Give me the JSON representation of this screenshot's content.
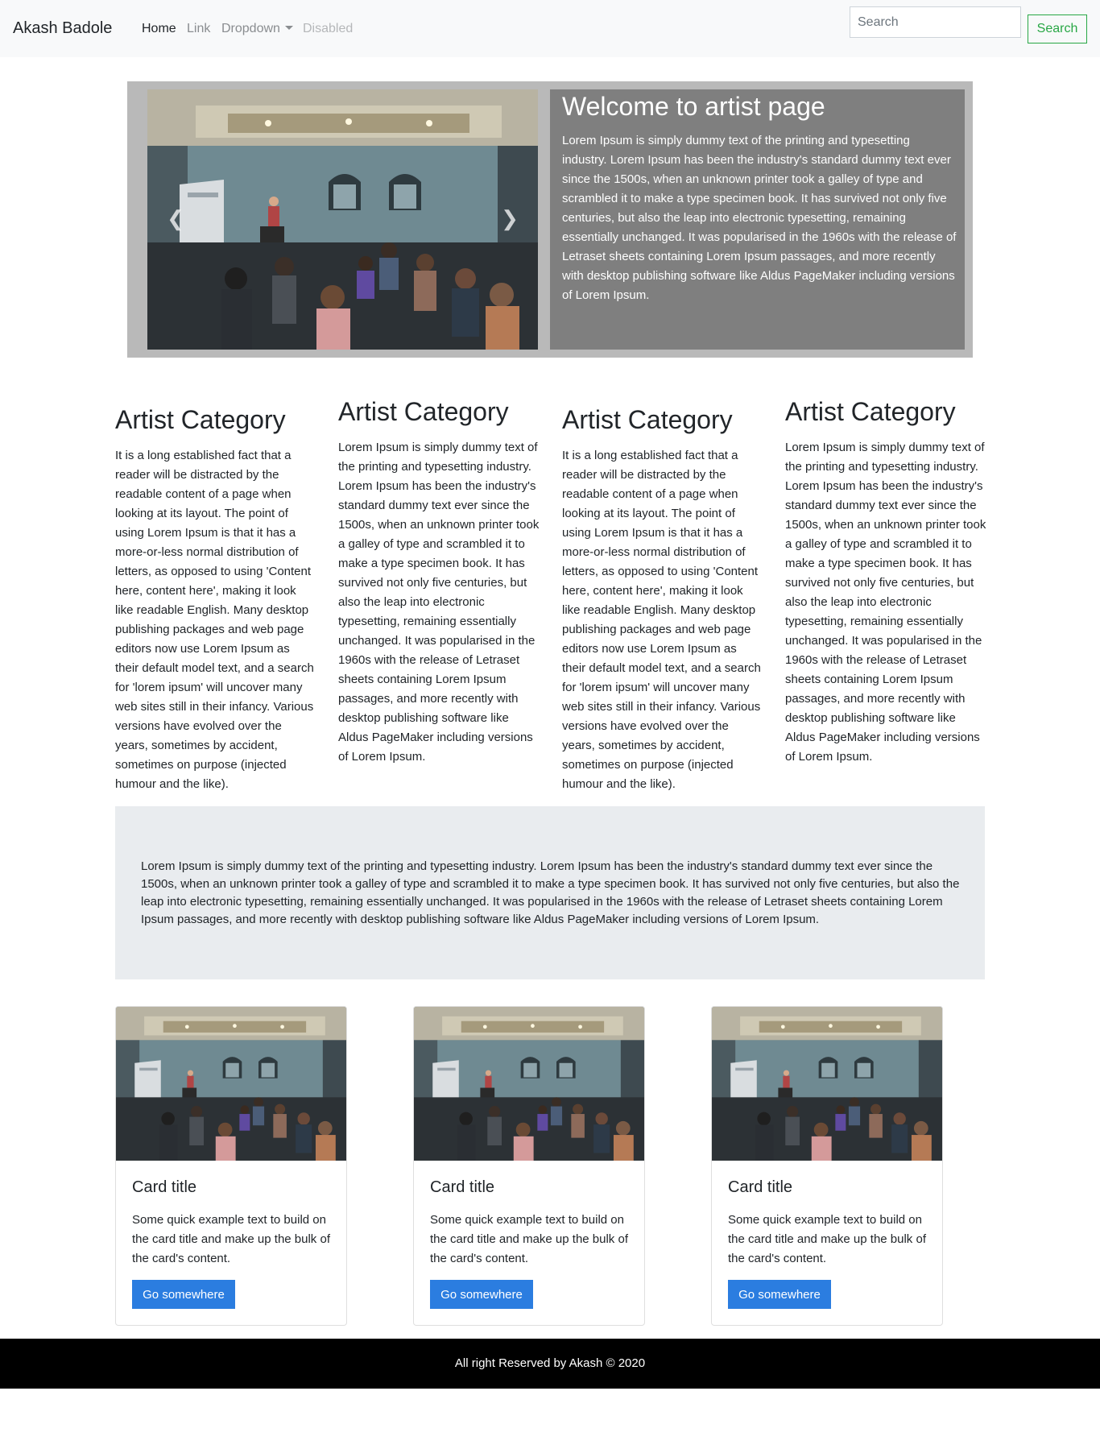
{
  "navbar": {
    "brand": "Akash Badole",
    "items": [
      {
        "label": "Home",
        "active": true
      },
      {
        "label": "Link"
      },
      {
        "label": "Dropdown"
      },
      {
        "label": "Disabled",
        "disabled": true
      }
    ],
    "search_placeholder": "Search",
    "search_button": "Search"
  },
  "hero": {
    "title": "Welcome to artist page",
    "text": "Lorem Ipsum is simply dummy text of the printing and typesetting industry. Lorem Ipsum has been the industry's standard dummy text ever since the 1500s, when an unknown printer took a galley of type and scrambled it to make a type specimen book. It has survived not only five centuries, but also the leap into electronic typesetting, remaining essentially unchanged. It was popularised in the 1960s with the release of Letraset sheets containing Lorem Ipsum passages, and more recently with desktop publishing software like Aldus PageMaker including versions of Lorem Ipsum."
  },
  "categories": [
    {
      "title": "Artist Category",
      "text": "It is a long established fact that a reader will be distracted by the readable content of a page when looking at its layout. The point of using Lorem Ipsum is that it has a more-or-less normal distribution of letters, as opposed to using 'Content here, content here', making it look like readable English. Many desktop publishing packages and web page editors now use Lorem Ipsum as their default model text, and a search for 'lorem ipsum' will uncover many web sites still in their infancy. Various versions have evolved over the years, sometimes by accident, sometimes on purpose (injected humour and the like)."
    },
    {
      "title": "Artist Category",
      "text": "Lorem Ipsum is simply dummy text of the printing and typesetting industry. Lorem Ipsum has been the industry's standard dummy text ever since the 1500s, when an unknown printer took a galley of type and scrambled it to make a type specimen book. It has survived not only five centuries, but also the leap into electronic typesetting, remaining essentially unchanged. It was popularised in the 1960s with the release of Letraset sheets containing Lorem Ipsum passages, and more recently with desktop publishing software like Aldus PageMaker including versions of Lorem Ipsum."
    },
    {
      "title": "Artist Category",
      "text": "It is a long established fact that a reader will be distracted by the readable content of a page when looking at its layout. The point of using Lorem Ipsum is that it has a more-or-less normal distribution of letters, as opposed to using 'Content here, content here', making it look like readable English. Many desktop publishing packages and web page editors now use Lorem Ipsum as their default model text, and a search for 'lorem ipsum' will uncover many web sites still in their infancy. Various versions have evolved over the years, sometimes by accident, sometimes on purpose (injected humour and the like)."
    },
    {
      "title": "Artist Category",
      "text": "Lorem Ipsum is simply dummy text of the printing and typesetting industry. Lorem Ipsum has been the industry's standard dummy text ever since the 1500s, when an unknown printer took a galley of type and scrambled it to make a type specimen book. It has survived not only five centuries, but also the leap into electronic typesetting, remaining essentially unchanged. It was popularised in the 1960s with the release of Letraset sheets containing Lorem Ipsum passages, and more recently with desktop publishing software like Aldus PageMaker including versions of Lorem Ipsum."
    }
  ],
  "jumbotron": {
    "text": "Lorem Ipsum is simply dummy text of the printing and typesetting industry. Lorem Ipsum has been the industry's standard dummy text ever since the 1500s, when an unknown printer took a galley of type and scrambled it to make a type specimen book. It has survived not only five centuries, but also the leap into electronic typesetting, remaining essentially unchanged. It was popularised in the 1960s with the release of Letraset sheets containing Lorem Ipsum passages, and more recently with desktop publishing software like Aldus PageMaker including versions of Lorem Ipsum."
  },
  "cards": [
    {
      "title": "Card title",
      "text": "Some quick example text to build on the card title and make up the bulk of the card's content.",
      "button": "Go somewhere"
    },
    {
      "title": "Card title",
      "text": "Some quick example text to build on the card title and make up the bulk of the card's content.",
      "button": "Go somewhere"
    },
    {
      "title": "Card title",
      "text": "Some quick example text to build on the card title and make up the bulk of the card's content.",
      "button": "Go somewhere"
    }
  ],
  "footer": {
    "text": "All right Reserved by Akash © 2020"
  },
  "colors": {
    "navbar_bg": "#f8f9fa",
    "success": "#28a745",
    "primary": "#2b7de0",
    "hero_frame": "#b9b9b9",
    "hero_panel": "#7f7f7f",
    "jumbotron_bg": "#e9ecef",
    "footer_bg": "#000000"
  }
}
